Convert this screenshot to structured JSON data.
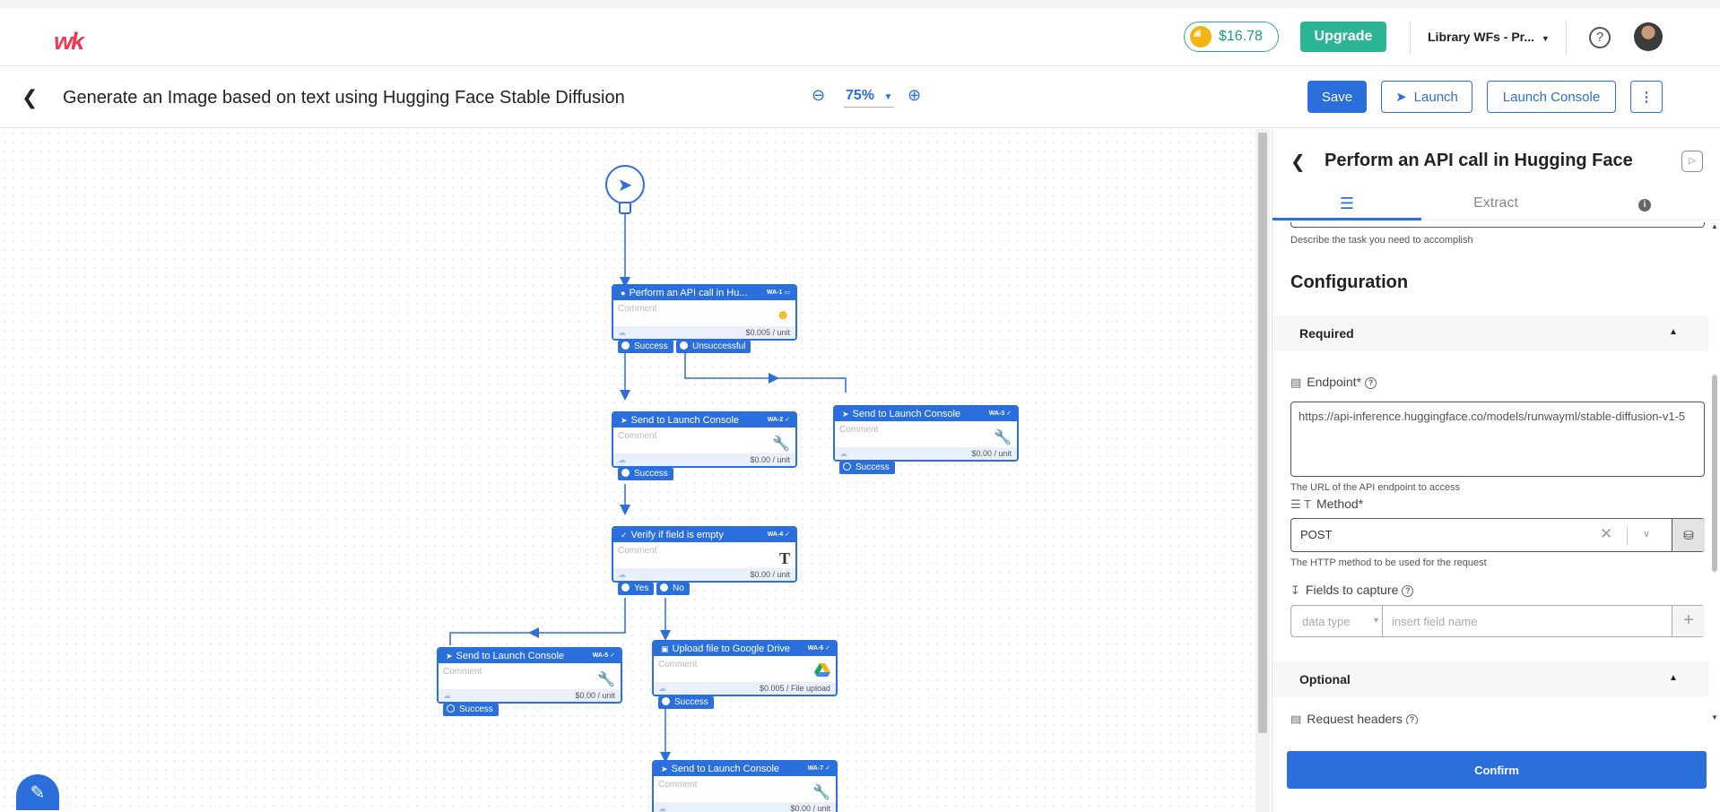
{
  "app": {
    "logo_text": "wk",
    "credits": "$16.78",
    "upgrade_label": "Upgrade",
    "workspace": "Library WFs - Pr...",
    "help_label": "?"
  },
  "toolbar": {
    "title": "Generate an Image based on text using Hugging Face Stable Diffusion",
    "zoom": "75%",
    "save_label": "Save",
    "launch_label": "Launch",
    "launch_console_label": "Launch Console",
    "more_label": "⋮"
  },
  "canvas": {
    "comment_placeholder": "Comment",
    "nodes": [
      {
        "title": "Perform an API call in Hu...",
        "id": "WA-1",
        "icon": "hugging-face-icon",
        "price": "$0.005 / unit"
      },
      {
        "title": "Send to Launch Console",
        "id": "WA-2",
        "icon": "wrench-icon",
        "price": "$0.00 / unit"
      },
      {
        "title": "Send to Launch Console",
        "id": "WA-3",
        "icon": "wrench-icon",
        "price": "$0.00 / unit"
      },
      {
        "title": "Verify if field is empty",
        "id": "WA-4",
        "icon": "text-t-icon",
        "price": "$0.00 / unit"
      },
      {
        "title": "Send to Launch Console",
        "id": "WA-5",
        "icon": "wrench-icon",
        "price": "$0.00 / unit"
      },
      {
        "title": "Upload file to Google Drive",
        "id": "WA-6",
        "icon": "google-drive-icon",
        "price": "$0.005 / File upload"
      },
      {
        "title": "Send to Launch Console",
        "id": "WA-7",
        "icon": "wrench-icon",
        "price": "$0.00 / unit"
      }
    ],
    "ports": {
      "success": "Success",
      "unsuccessful": "Unsuccessful",
      "yes": "Yes",
      "no": "No"
    }
  },
  "panel": {
    "title": "Perform an API call in Hugging Face",
    "tabs": [
      "",
      "Extract",
      ""
    ],
    "describe_helper": "Describe the task you need to accomplish",
    "config_heading": "Configuration",
    "required_label": "Required",
    "endpoint_label": "Endpoint*",
    "endpoint_value": "https://api-inference.huggingface.co/models/runwayml/stable-diffusion-v1-5",
    "endpoint_helper": "The URL of the API endpoint to access",
    "method_label": "Method*",
    "method_value": "POST",
    "method_helper": "The HTTP method to be used for the request",
    "fields_label": "Fields to capture",
    "data_type_placeholder": "data type",
    "field_name_placeholder": "insert field name",
    "optional_label": "Optional",
    "request_headers_label": "Request headers",
    "confirm_label": "Confirm"
  },
  "colors": {
    "primary": "#2a6fdb",
    "success_green": "#2bb594",
    "logo_red": "#ee3a52"
  }
}
